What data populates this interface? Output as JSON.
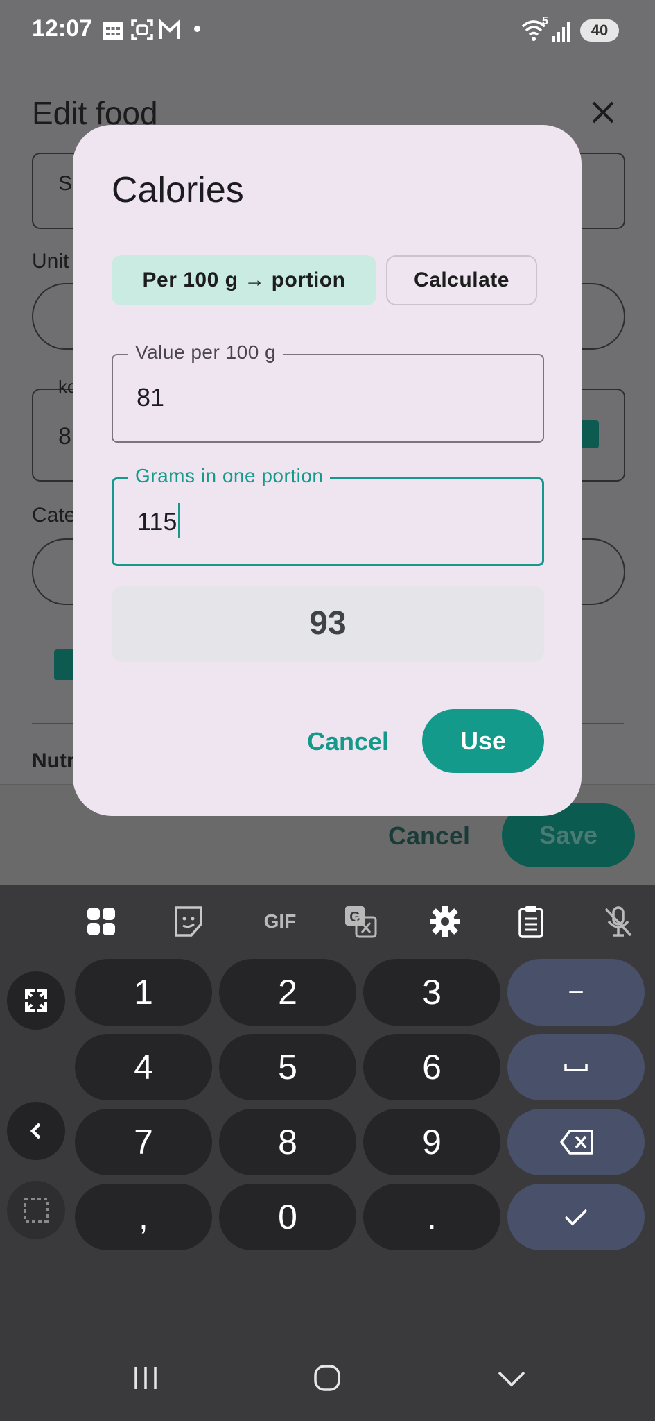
{
  "status_bar": {
    "time": "12:07",
    "battery": "40",
    "wifi_badge": "5",
    "mail_icon_letter": "M"
  },
  "background_page": {
    "title": "Edit food",
    "name_field_partial": "S",
    "unit_label_partial": "Unit",
    "kcal_label_partial": "kc",
    "kcal_value_partial": "8",
    "category_label_partial": "Cate",
    "nutr_label_partial": "Nutr",
    "cancel_label": "Cancel",
    "save_label": "Save"
  },
  "dialog": {
    "title": "Calories",
    "mode_tabs": [
      {
        "label": "Per 100 g → portion",
        "selected": true
      },
      {
        "label": "Calculate",
        "selected": false
      }
    ],
    "value_field": {
      "label": "Value per 100 g",
      "value": "81"
    },
    "grams_field": {
      "label": "Grams in one portion",
      "value": "115"
    },
    "result": "93",
    "cancel_label": "Cancel",
    "use_label": "Use"
  },
  "keyboard": {
    "toolbar": [
      "apps-icon",
      "sticker-icon",
      "GIF",
      "translate-icon",
      "gear-icon",
      "clipboard-icon",
      "mic-off-icon"
    ],
    "gif_label": "GIF",
    "translate_letter": "G",
    "rows": [
      [
        "1",
        "2",
        "3",
        "−"
      ],
      [
        "4",
        "5",
        "6",
        "␣"
      ],
      [
        "7",
        "8",
        "9",
        "⌫"
      ],
      [
        ",",
        "0",
        ".",
        "✓"
      ]
    ]
  },
  "colors": {
    "accent": "#149a8a",
    "dialog_bg": "#efe5f1",
    "keyboard_bg": "#3a3a3c"
  }
}
